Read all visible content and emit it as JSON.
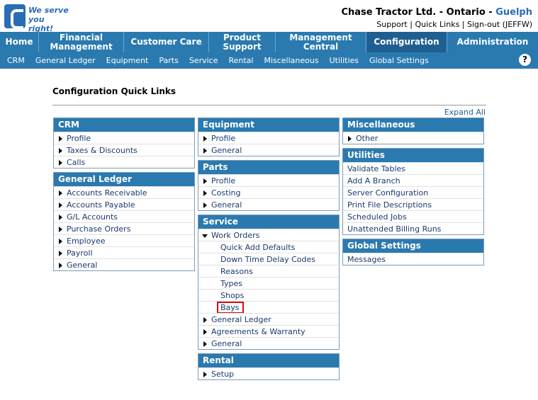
{
  "logo": {
    "tagline_line1": "We serve",
    "tagline_line2": "you right!"
  },
  "company": {
    "name": "Chase Tractor Ltd. - Ontario - ",
    "branch": "Guelph"
  },
  "toplinks": "Support | Quick Links | Sign-out (JEFFW)",
  "mainnav": [
    {
      "label": "Home"
    },
    {
      "label": "Financial Management"
    },
    {
      "label": "Customer Care"
    },
    {
      "label": "Product Support"
    },
    {
      "label": "Management Central"
    },
    {
      "label": "Configuration",
      "active": true
    },
    {
      "label": "Administration"
    }
  ],
  "subnav": [
    "CRM",
    "General Ledger",
    "Equipment",
    "Parts",
    "Service",
    "Rental",
    "Miscellaneous",
    "Utilities",
    "Global Settings"
  ],
  "help_icon": "?",
  "page_title": "Configuration Quick Links",
  "expand_all": "Expand All",
  "panels": {
    "crm": {
      "title": "CRM",
      "items": [
        "Profile",
        "Taxes & Discounts",
        "Calls"
      ]
    },
    "gl": {
      "title": "General Ledger",
      "items": [
        "Accounts Receivable",
        "Accounts Payable",
        "G/L Accounts",
        "Purchase Orders",
        "Employee",
        "Payroll",
        "General"
      ]
    },
    "equipment": {
      "title": "Equipment",
      "items": [
        "Profile",
        "General"
      ]
    },
    "parts": {
      "title": "Parts",
      "items": [
        "Profile",
        "Costing",
        "General"
      ]
    },
    "service": {
      "title": "Service",
      "work_orders": "Work Orders",
      "sub_items": [
        "Quick Add Defaults",
        "Down Time Delay Codes",
        "Reasons",
        "Types",
        "Shops",
        "Bays"
      ],
      "items": [
        "General Ledger",
        "Agreements & Warranty",
        "General"
      ]
    },
    "rental": {
      "title": "Rental",
      "items": [
        "Setup"
      ]
    },
    "misc": {
      "title": "Miscellaneous",
      "items": [
        "Other"
      ]
    },
    "utilities": {
      "title": "Utilities",
      "items": [
        "Validate Tables",
        "Add A Branch",
        "Server Configuration",
        "Print File Descriptions",
        "Scheduled Jobs",
        "Unattended Billing Runs"
      ]
    },
    "global": {
      "title": "Global Settings",
      "items": [
        "Messages"
      ]
    }
  }
}
